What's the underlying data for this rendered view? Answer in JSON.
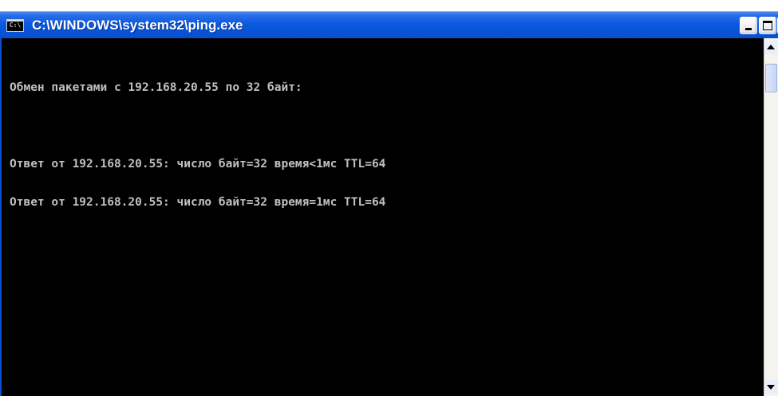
{
  "window": {
    "title": "C:\\WINDOWS\\system32\\ping.exe",
    "icon": "console-app-icon",
    "icon_label": "C:\\"
  },
  "console": {
    "lines": [
      "Обмен пакетами с 192.168.20.55 по 32 байт:",
      "",
      "Ответ от 192.168.20.55: число байт=32 время<1мс TTL=64",
      "Ответ от 192.168.20.55: число байт=32 время=1мс TTL=64"
    ],
    "text_color": "#c0c0c0",
    "background_color": "#000000"
  },
  "controls": {
    "minimize_icon": "minimize-icon",
    "maximize_icon": "maximize-icon",
    "close_icon": "close-icon",
    "close_glyph": "×"
  },
  "colors": {
    "titlebar": "#0553d7",
    "title_text": "#ffffff"
  }
}
